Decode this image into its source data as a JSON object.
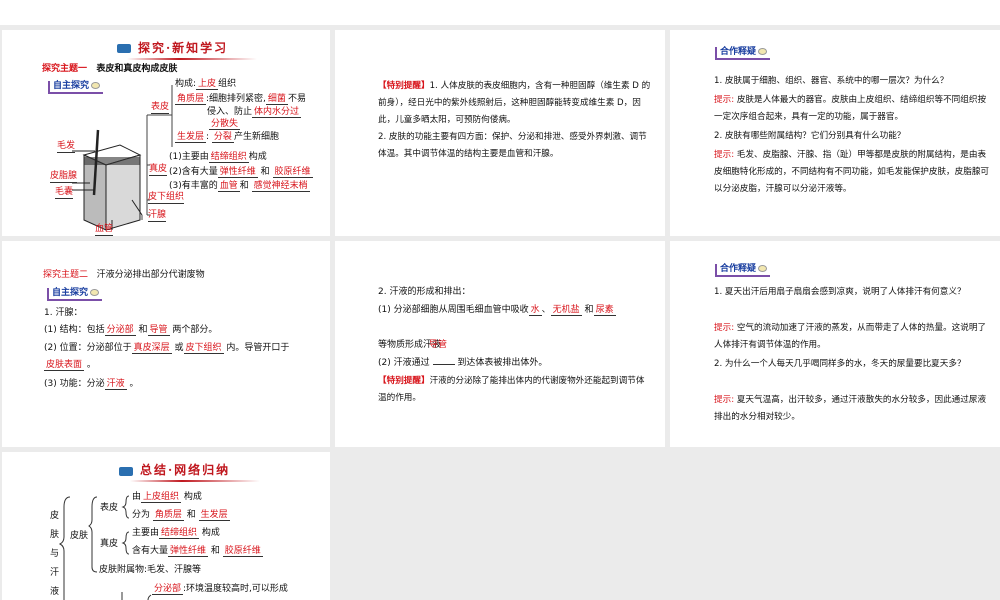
{
  "slide1": {
    "header": "探究·新知学习",
    "topic_label": "探究主题一",
    "topic": "表皮和真皮构成皮肤",
    "tag": "自主探究",
    "labels": {
      "hair": "毛发",
      "sebaceous": "皮脂腺",
      "follicle": "毛囊",
      "vessel": "血管",
      "epidermis": "表皮",
      "dermis": "真皮",
      "subcutis": "皮下组织",
      "sweat": "汗腺"
    },
    "epi_comp": "构成:",
    "epi_comp_ans": "上皮",
    "epi_comp_end": "组织",
    "stratum_corneum": "角质层",
    "sc_text1": ":细胞排列紧密,",
    "sc_ans1": "细菌",
    "sc_text2": "不易",
    "sc_text3": "侵入、防止",
    "sc_ans2": "体内水分过",
    "sc_ans3": "分散失",
    "stratum_basale": "生发层",
    "sb_ans": "分裂",
    "sb_text": "产生新细胞",
    "d1": "(1)主要由",
    "d1_ans": "结缔组织",
    "d1_end": "构成",
    "d2": "(2)含有大量",
    "d2_ans1": "弹性纤维",
    "d2_and": "和",
    "d2_ans2": "胶原纤维",
    "d3": "(3)有丰富的",
    "d3_ans1": "血管",
    "d3_and": "和",
    "d3_ans2": "感觉神经末梢"
  },
  "slide2": {
    "tip_label": "【特别提醒】",
    "p1": "1. 人体皮肤的表皮细胞内，含有一种胆固醇（维生素 D 的前身），经日光中的紫外线照射后，这种胆固醇能转变成维生素 D，因此，儿童多晒太阳，可预防佝偻病。",
    "p2": "2. 皮肤的功能主要有四方面：保护、分泌和排泄、感受外界刺激、调节体温。其中调节体温的结构主要是血管和汗腺。"
  },
  "slide3": {
    "tag": "合作释疑",
    "q1": "1. 皮肤属于细胞、组织、器官、系统中的哪一层次？为什么？",
    "hint": "提示:",
    "a1": "皮肤是人体最大的器官。皮肤由上皮组织、结缔组织等不同组织按一定次序组合起来，具有一定的功能，属于器官。",
    "q2": "2. 皮肤有哪些附属结构？它们分别具有什么功能？",
    "a2": "毛发、皮脂腺、汗腺、指（趾）甲等都是皮肤的附属结构，是由表皮细胞特化形成的，不同结构有不同功能，如毛发能保护皮肤，皮脂腺可以分泌皮脂，汗腺可以分泌汗液等。"
  },
  "slide4": {
    "topic_label": "探究主题二",
    "topic": "汗液分泌排出部分代谢废物",
    "tag": "自主探究",
    "l1": "1. 汗腺：",
    "l2a": "(1) 结构：包括",
    "l2_ans1": "分泌部",
    "l2b": "和",
    "l2_ans2": "导管",
    "l2c": "两个部分。",
    "l3a": "(2) 位置：分泌部位于",
    "l3_ans1": "真皮深层",
    "l3b": "或",
    "l3_ans2": "皮下组织",
    "l3c": "内。导管开口于",
    "l3_ans3": "皮肤表面",
    "l3d": "。",
    "l4a": "(3) 功能：分泌",
    "l4_ans": "汗液",
    "l4b": "。"
  },
  "slide5": {
    "l1": "2. 汗液的形成和排出：",
    "l2a": "(1) 分泌部细胞从周围毛细血管中吸收",
    "ans1": "水",
    "sep": "、",
    "ans2": "无机盐",
    "and": "和",
    "ans3": "尿素",
    "l3": "等物质形成汗液",
    "ans4": "导管",
    "l4a": "(2) 汗液通过",
    "l4b": "到达体表被排出体外。",
    "tip_label": "【特别提醒】",
    "tip": "汗液的分泌除了能排出体内的代谢废物外还能起到调节体温的作用。"
  },
  "slide6": {
    "tag": "合作释疑",
    "q1": "1. 夏天出汗后用扇子扇扇会感到凉爽，说明了人体排汗有何意义？",
    "hint": "提示:",
    "a1": "空气的流动加速了汗液的蒸发，从而带走了人体的热量。这说明了人体排汗有调节体温的作用。",
    "q2": "2. 为什么一个人每天几乎喝同样多的水，冬天的尿量要比夏天多？",
    "a2": "夏天气温高，出汗较多，通过汗液散失的水分较多，因此通过尿液排出的水分相对较少。"
  },
  "slide7": {
    "header": "总结·网络归纳",
    "root": [
      "皮",
      "肤",
      "与",
      "汗",
      "液"
    ],
    "skin": "皮肤",
    "epi": "表皮",
    "e1a": "由",
    "e1_ans": "上皮组织",
    "e1b": "构成",
    "e2a": "分为",
    "e2_ans1": "角质层",
    "e2_and": "和",
    "e2_ans2": "生发层",
    "derm": "真皮",
    "d1a": "主要由",
    "d1_ans": "结缔组织",
    "d1b": "构成",
    "d2a": "含有大量",
    "d2_ans1": "弹性纤维",
    "d2_and": "和",
    "d2_ans2": "胶原纤维",
    "append": "皮肤附属物:毛发、汗腺等",
    "s_ans": "分泌部",
    "s_text": ":环境温度较高时,可以形成"
  }
}
